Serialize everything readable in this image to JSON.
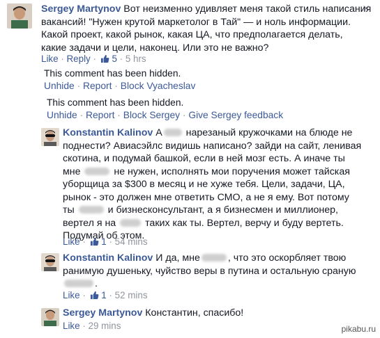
{
  "comments": [
    {
      "author": "Sergey Martynov",
      "lines": [
        "Вот неизменно удивляет меня такой стиль написания",
        "вакансий! \"Нужен крутой маркетолог в Тай\" — и ноль информации.",
        "Какой проект, какой рынок, какая ЦА, что предполагается делать,",
        "какие задачи и цели, наконец. Или это не важно?"
      ],
      "like": "Like",
      "reply": "Reply",
      "likes": "5",
      "time": "5 hrs"
    },
    {
      "author": "Konstantin Kalinov",
      "lines": [
        "нарезаный кружочками на блюде не",
        "поднести? Авиасэйлс видишь написано? зайди на сайт, ленивая",
        "скотина, и подумай башкой, если в ней мозг есть. А иначе ты",
        "не нужен, исполнять мои поручения может тайская",
        "уборщица за $300 в месяц и не хуже тебя. Цели, задачи, ЦА,",
        "рынок - это должен мне ответить СМО, а не я ему. Вот потому",
        "и бизнесконсультант, а я бизнесмен и миллионер,",
        "вертел я на",
        "таких как ты. Вертел, верчу и буду вертеть.",
        "Подумай об этом."
      ],
      "lead": "А",
      "line4_lead": "мне",
      "line7_lead": "ты",
      "like": "Like",
      "likes": "1",
      "time": "54 mins"
    },
    {
      "author": "Konstantin Kalinov",
      "lead": "И да, мне",
      "lines": [
        ", что это оскорбляет твою",
        "ранимую душеньку, чуйство веры в путина и остальную сраную",
        "."
      ],
      "like": "Like",
      "likes": "1",
      "time": "52 mins"
    },
    {
      "author": "Sergey Martynov",
      "text": "Константин, спасибо!",
      "like": "Like",
      "time": "29 mins"
    }
  ],
  "hidden": [
    {
      "note": "This comment has been hidden.",
      "unhide": "Unhide",
      "report": "Report",
      "block": "Block Vyacheslav"
    },
    {
      "note": "This comment has been hidden.",
      "unhide": "Unhide",
      "report": "Report",
      "block": "Block Sergey",
      "feedback": "Give Sergey feedback"
    }
  ],
  "separator": "·",
  "close_glyph": "✕",
  "watermark": "pikabu.ru",
  "colors": {
    "link": "#3b5998",
    "meta": "#90949c",
    "text": "#141823"
  },
  "icons": {
    "like": "thumbs-up-icon",
    "close": "close-icon"
  }
}
